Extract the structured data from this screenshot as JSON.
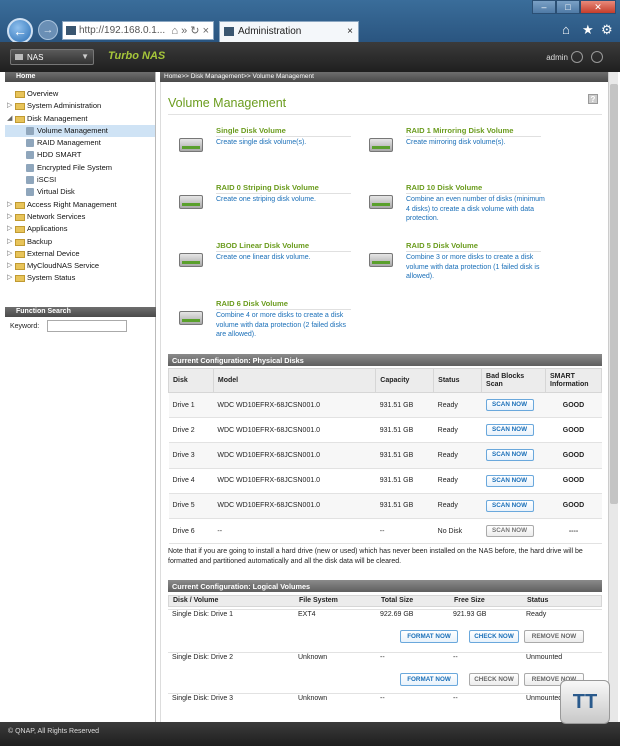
{
  "browser": {
    "address": "http://192.168.0.1...",
    "tab_title": "Administration",
    "titlebar": {
      "minimize": "–",
      "maximize": "□",
      "close": "✕"
    },
    "back": "←",
    "forward": "→",
    "addr_controls": "⌂ » ↻ ×",
    "tab_close": "×",
    "right_icons": [
      "⌂",
      "★",
      "⚙"
    ]
  },
  "appbar": {
    "nas_label": "NAS",
    "brand": "Turbo NAS",
    "user": "admin",
    "select_arrow": "▼"
  },
  "sidebar": {
    "header": "Home",
    "items": [
      {
        "label": "Overview",
        "toggle": ""
      },
      {
        "label": "System Administration",
        "toggle": "▷"
      },
      {
        "label": "Disk Management",
        "toggle": "◢"
      },
      {
        "label": "Volume Management",
        "child": true,
        "selected": true
      },
      {
        "label": "RAID Management",
        "child": true
      },
      {
        "label": "HDD SMART",
        "child": true
      },
      {
        "label": "Encrypted File System",
        "child": true
      },
      {
        "label": "iSCSI",
        "child": true
      },
      {
        "label": "Virtual Disk",
        "child": true
      },
      {
        "label": "Access Right Management",
        "toggle": "▷"
      },
      {
        "label": "Network Services",
        "toggle": "▷"
      },
      {
        "label": "Applications",
        "toggle": "▷"
      },
      {
        "label": "Backup",
        "toggle": "▷"
      },
      {
        "label": "External Device",
        "toggle": "▷"
      },
      {
        "label": "MyCloudNAS Service",
        "toggle": "▷"
      },
      {
        "label": "System Status",
        "toggle": "▷"
      }
    ],
    "function_search": {
      "header": "Function Search",
      "keyword_label": "Keyword:",
      "keyword_value": ""
    }
  },
  "breadcrumb": "Home>> Disk Management>> Volume Management",
  "main": {
    "title": "Volume Management",
    "help": "?",
    "volume_types": [
      {
        "name": "Single Disk Volume",
        "desc": "Create single disk volume(s)."
      },
      {
        "name": "RAID 1 Mirroring Disk Volume",
        "desc": "Create mirroring disk volume(s)."
      },
      {
        "name": "RAID 0 Striping Disk Volume",
        "desc": "Create one striping disk volume."
      },
      {
        "name": "RAID 10 Disk Volume",
        "desc": "Combine an even number of disks (minimum 4 disks) to create a disk volume with data protection."
      },
      {
        "name": "JBOD Linear Disk Volume",
        "desc": "Create one linear disk volume."
      },
      {
        "name": "RAID 5 Disk Volume",
        "desc": "Combine 3 or more disks to create a disk volume with data protection (1 failed disk is allowed)."
      },
      {
        "name": "RAID 6 Disk Volume",
        "desc": "Combine 4 or more disks to create a disk volume with data protection (2 failed disks are allowed)."
      }
    ],
    "physical": {
      "header": "Current Configuration: Physical Disks",
      "columns": [
        "Disk",
        "Model",
        "Capacity",
        "Status",
        "Bad Blocks Scan",
        "SMART Information"
      ],
      "rows": [
        {
          "disk": "Drive 1",
          "model": "WDC WD10EFRX-68JCSN001.0",
          "capacity": "931.51 GB",
          "status": "Ready",
          "scan": "SCAN NOW",
          "smart": "GOOD"
        },
        {
          "disk": "Drive 2",
          "model": "WDC WD10EFRX-68JCSN001.0",
          "capacity": "931.51 GB",
          "status": "Ready",
          "scan": "SCAN NOW",
          "smart": "GOOD"
        },
        {
          "disk": "Drive 3",
          "model": "WDC WD10EFRX-68JCSN001.0",
          "capacity": "931.51 GB",
          "status": "Ready",
          "scan": "SCAN NOW",
          "smart": "GOOD"
        },
        {
          "disk": "Drive 4",
          "model": "WDC WD10EFRX-68JCSN001.0",
          "capacity": "931.51 GB",
          "status": "Ready",
          "scan": "SCAN NOW",
          "smart": "GOOD"
        },
        {
          "disk": "Drive 5",
          "model": "WDC WD10EFRX-68JCSN001.0",
          "capacity": "931.51 GB",
          "status": "Ready",
          "scan": "SCAN NOW",
          "smart": "GOOD"
        },
        {
          "disk": "Drive 6",
          "model": "--",
          "capacity": "--",
          "status": "No Disk",
          "scan": "SCAN NOW",
          "smart": "----"
        }
      ]
    },
    "note": "Note that if you are going to install a hard drive (new or used) which has never been installed on the NAS before, the hard drive will be formatted and partitioned automatically and all the disk data will be cleared.",
    "logical": {
      "header": "Current Configuration: Logical Volumes",
      "columns": [
        "Disk / Volume",
        "File System",
        "Total Size",
        "Free Size",
        "Status"
      ],
      "rows": [
        {
          "volume": "Single Disk: Drive 1",
          "fs": "EXT4",
          "total": "922.69 GB",
          "free": "921.93 GB",
          "status": "Ready",
          "buttons": [
            "FORMAT NOW",
            "CHECK NOW",
            "REMOVE NOW"
          ]
        },
        {
          "volume": "Single Disk: Drive 2",
          "fs": "Unknown",
          "total": "--",
          "free": "--",
          "status": "Unmounted",
          "buttons": [
            "FORMAT NOW",
            "CHECK NOW",
            "REMOVE NOW"
          ]
        },
        {
          "volume": "Single Disk: Drive 3",
          "fs": "Unknown",
          "total": "--",
          "free": "--",
          "status": "Unmounted"
        }
      ]
    }
  },
  "footer": "© QNAP, All Rights Reserved",
  "watermark": "TT"
}
